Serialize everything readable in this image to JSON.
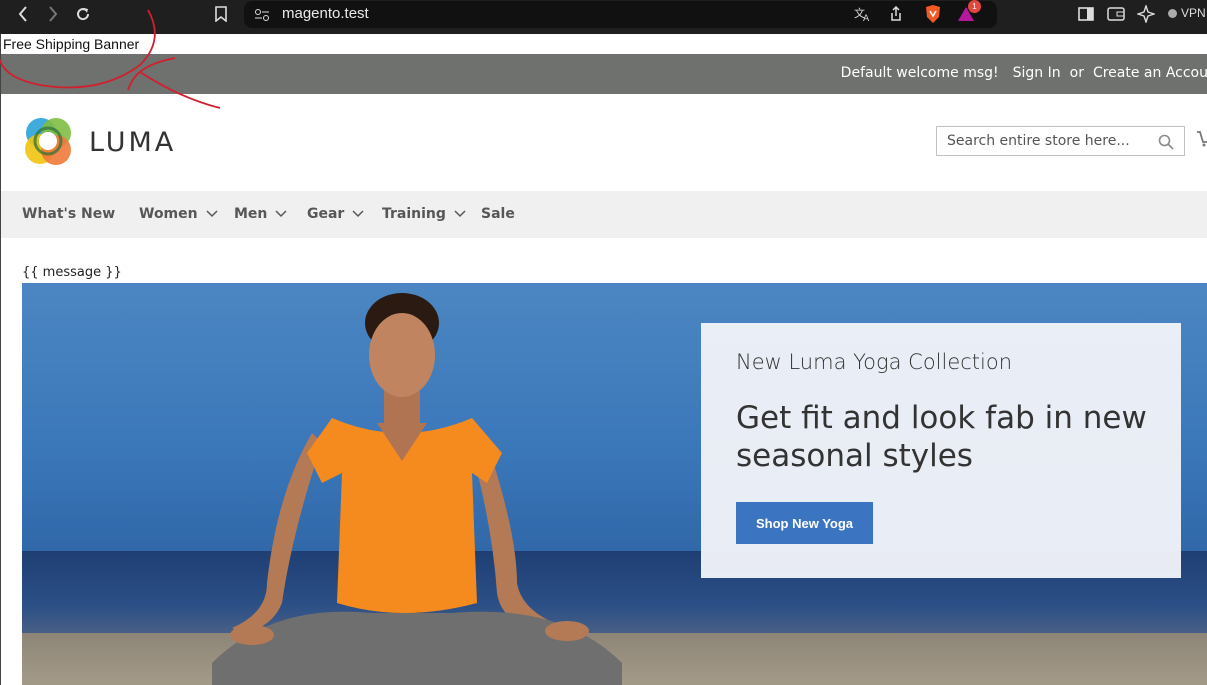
{
  "browser": {
    "url": "magento.test",
    "notification_count": "1",
    "vpn_label": "VPN"
  },
  "banner": {
    "free_shipping": "Free Shipping Banner"
  },
  "header": {
    "welcome": "Default welcome msg!",
    "sign_in": "Sign In",
    "or": "or",
    "create_account": "Create an Accou"
  },
  "logo": {
    "text": "LUMA"
  },
  "search": {
    "placeholder": "Search entire store here..."
  },
  "nav": {
    "items": [
      {
        "label": "What's New"
      },
      {
        "label": "Women"
      },
      {
        "label": "Men"
      },
      {
        "label": "Gear"
      },
      {
        "label": "Training"
      },
      {
        "label": "Sale"
      }
    ]
  },
  "message": "{{ message }}",
  "promo": {
    "subtitle": "New Luma Yoga Collection",
    "title": "Get fit and look fab in new seasonal styles",
    "button": "Shop New Yoga"
  },
  "colors": {
    "header_bar": "#6e716e",
    "nav_bg": "#f0f0f0",
    "button": "#3b75c1",
    "annotation": "#d21f2e"
  }
}
